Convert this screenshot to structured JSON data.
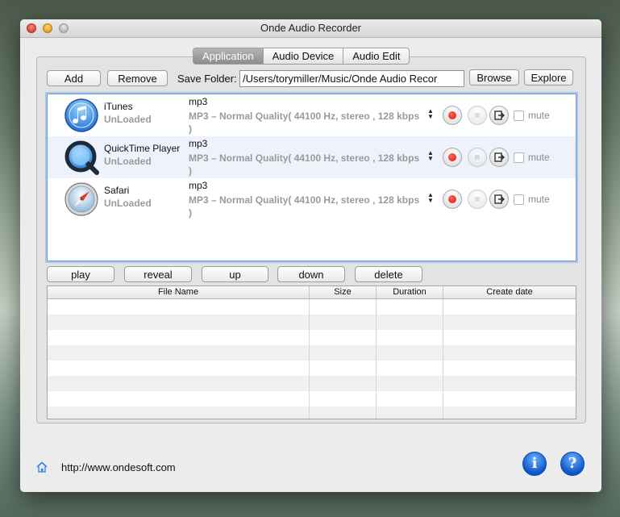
{
  "window": {
    "title": "Onde Audio Recorder"
  },
  "tabs": [
    {
      "label": "Application",
      "active": true
    },
    {
      "label": "Audio Device",
      "active": false
    },
    {
      "label": "Audio Edit",
      "active": false
    }
  ],
  "toolbar": {
    "add_label": "Add",
    "remove_label": "Remove",
    "save_folder_label": "Save Folder:",
    "save_folder_value": "/Users/torymiller/Music/Onde Audio Recor",
    "browse_label": "Browse",
    "explore_label": "Explore"
  },
  "apps": [
    {
      "name": "iTunes",
      "status": "UnLoaded",
      "format": "mp3",
      "detail": "MP3 – Normal Quality( 44100 Hz, stereo , 128 kbps )",
      "mute_label": "mute",
      "icon": "itunes-icon"
    },
    {
      "name": "QuickTime Player",
      "status": "UnLoaded",
      "format": "mp3",
      "detail": "MP3 – Normal Quality( 44100 Hz, stereo , 128 kbps )",
      "mute_label": "mute",
      "icon": "quicktime-icon"
    },
    {
      "name": "Safari",
      "status": "UnLoaded",
      "format": "mp3",
      "detail": "MP3 – Normal Quality( 44100 Hz, stereo , 128 kbps )",
      "mute_label": "mute",
      "icon": "safari-icon"
    }
  ],
  "file_actions": {
    "play_label": "play",
    "reveal_label": "reveal",
    "up_label": "up",
    "down_label": "down",
    "delete_label": "delete"
  },
  "file_table": {
    "columns": [
      "File Name",
      "Size",
      "Duration",
      "Create date"
    ]
  },
  "footer": {
    "url": "http://www.ondesoft.com"
  },
  "colors": {
    "record": "#d90f0f",
    "selection_border": "#6e9bd3",
    "info_button": "#0b57c8"
  }
}
